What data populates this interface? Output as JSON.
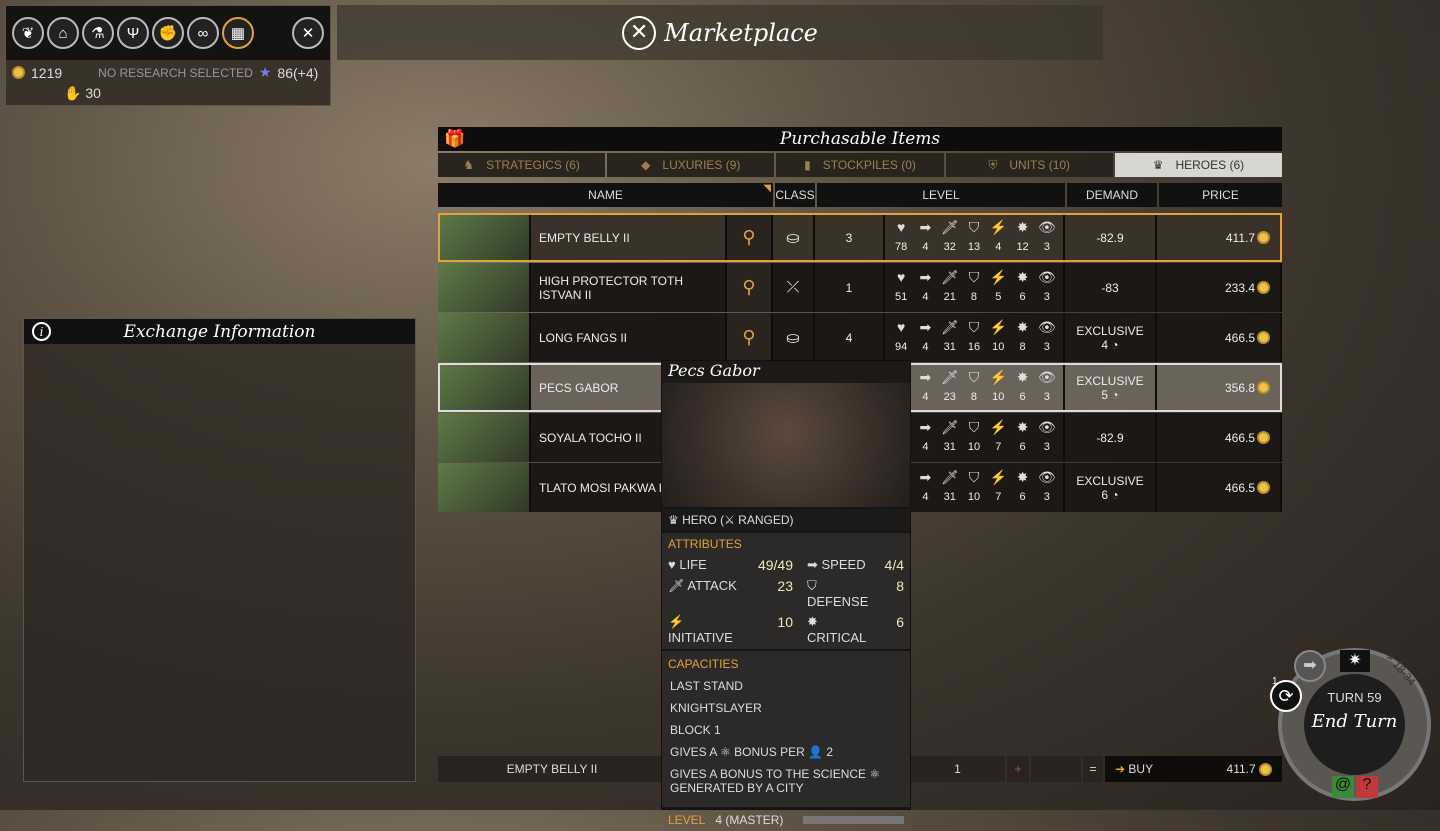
{
  "topbar": {
    "icons": [
      "laurel-icon",
      "capitol-icon",
      "flask-icon",
      "chalice-icon",
      "fist-icon",
      "handshake-icon",
      "marketplace-icon",
      "tools-icon"
    ],
    "dust": "1219",
    "research": "NO RESEARCH SELECTED",
    "influence": "86(+4)",
    "food": "30"
  },
  "title": "Marketplace",
  "exchange": {
    "title": "Exchange Information"
  },
  "panel": {
    "title": "Purchasable Items",
    "tabs": [
      {
        "label": "STRATEGICS (6)"
      },
      {
        "label": "LUXURIES (9)"
      },
      {
        "label": "STOCKPILES (0)"
      },
      {
        "label": "UNITS (10)"
      },
      {
        "label": "HEROES (6)"
      }
    ],
    "columns": [
      "NAME",
      "CLASS",
      "LEVEL",
      "DEMAND",
      "PRICE"
    ],
    "rows": [
      {
        "name": "EMPTY BELLY II",
        "level": "3",
        "stats": [
          "78",
          "4",
          "32",
          "13",
          "4",
          "12",
          "3"
        ],
        "demand": "-82.9",
        "demand2": "",
        "price": "411.7"
      },
      {
        "name": "HIGH PROTECTOR TOTH ISTVAN II",
        "level": "1",
        "stats": [
          "51",
          "4",
          "21",
          "8",
          "5",
          "6",
          "3"
        ],
        "demand": "-83",
        "demand2": "",
        "price": "233.4"
      },
      {
        "name": "LONG FANGS II",
        "level": "4",
        "stats": [
          "94",
          "4",
          "31",
          "16",
          "10",
          "8",
          "3"
        ],
        "demand": "EXCLUSIVE",
        "demand2": "4",
        "price": "466.5"
      },
      {
        "name": "PECS GABOR",
        "level": "",
        "stats": [
          "",
          "4",
          "23",
          "8",
          "10",
          "6",
          "3"
        ],
        "demand": "EXCLUSIVE",
        "demand2": "5",
        "price": "356.8"
      },
      {
        "name": "SOYALA TOCHO II",
        "level": "",
        "stats": [
          "",
          "4",
          "31",
          "10",
          "7",
          "6",
          "3"
        ],
        "demand": "-82.9",
        "demand2": "",
        "price": "466.5"
      },
      {
        "name": "TLATO MOSI PAKWA II",
        "level": "",
        "stats": [
          "",
          "4",
          "31",
          "10",
          "7",
          "6",
          "3"
        ],
        "demand": "EXCLUSIVE",
        "demand2": "6",
        "price": "466.5"
      }
    ]
  },
  "buybar": {
    "name": "EMPTY BELLY II",
    "qty": "1",
    "plus": "+",
    "eq": "=",
    "buy": "BUY",
    "price": "411.7"
  },
  "tooltip": {
    "name": "Pecs Gabor",
    "class": "HERO (⚔ RANGED)",
    "attributes_label": "ATTRIBUTES",
    "life_l": "LIFE",
    "life": "49/49",
    "speed_l": "SPEED",
    "speed": "4/4",
    "attack_l": "ATTACK",
    "attack": "23",
    "defense_l": "DEFENSE",
    "defense": "8",
    "init_l": "INITIATIVE",
    "init": "10",
    "crit_l": "CRITICAL",
    "crit": "6",
    "capacities_label": "CAPACITIES",
    "capacities": [
      "LAST STAND",
      "KNIGHTSLAYER",
      "BLOCK 1",
      "GIVES A ⚛ BONUS PER 👤 2",
      "GIVES A BONUS TO THE SCIENCE ⚛ GENERATED BY A CITY"
    ],
    "level_label": "LEVEL",
    "level": "4 (MASTER)"
  },
  "endturn": {
    "turn": "TURN 59",
    "label": "End Turn",
    "time": "18-34",
    "badge": "1",
    "help": "?"
  }
}
